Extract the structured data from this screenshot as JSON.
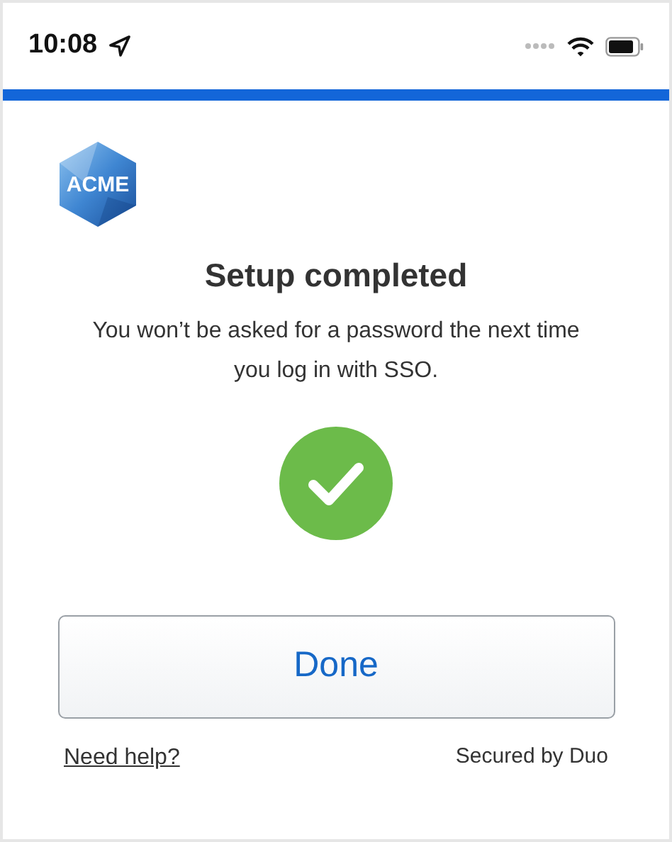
{
  "status_bar": {
    "time": "10:08"
  },
  "logo": {
    "text": "ACME"
  },
  "title": "Setup completed",
  "message": "You won’t be asked for a password the next time you log in with SSO.",
  "buttons": [
    {
      "label": "Done"
    }
  ],
  "footer": {
    "help_link": "Need help?",
    "secured_by": "Secured by Duo"
  }
}
